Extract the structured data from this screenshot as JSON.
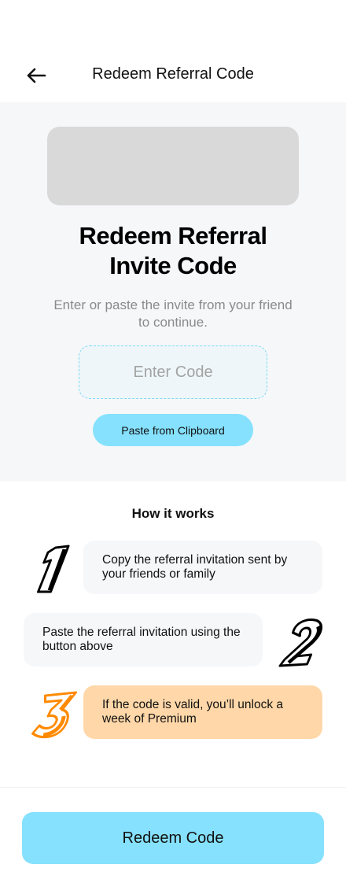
{
  "header": {
    "title": "Redeem Referral Code",
    "back_icon": "arrow-left-icon"
  },
  "hero": {
    "heading_line1": "Redeem Referral",
    "heading_line2": "Invite Code",
    "subtitle": "Enter or paste the invite from your friend to continue.",
    "code_input": {
      "value": "",
      "placeholder": "Enter Code"
    },
    "paste_button_label": "Paste from Clipboard"
  },
  "how_it_works": {
    "title": "How it works",
    "steps": [
      {
        "number": "1",
        "text": "Copy the referral invitation sent by your friends or family"
      },
      {
        "number": "2",
        "text": "Paste the referral invitation using the button above"
      },
      {
        "number": "3",
        "text": "If the code is valid, you’ll unlock a week of Premium"
      }
    ]
  },
  "footer": {
    "redeem_button_label": "Redeem Code"
  },
  "colors": {
    "accent": "#85e1fd",
    "highlight": "#ffd7a8",
    "step3_number": "#ff8a00",
    "background_gray": "#f6f7f9"
  }
}
